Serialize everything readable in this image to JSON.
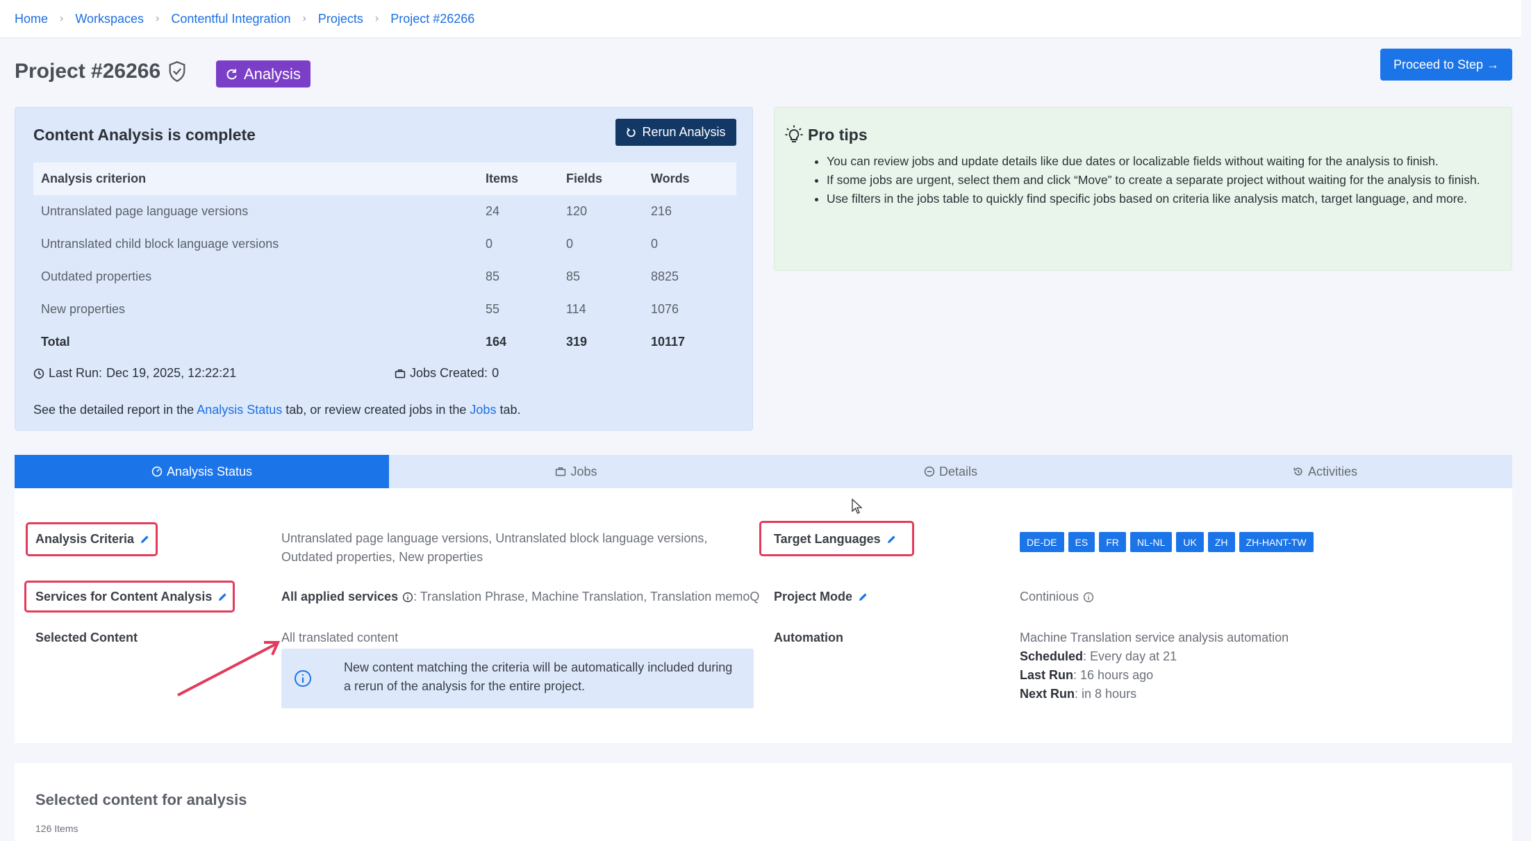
{
  "breadcrumb": [
    "Home",
    "Workspaces",
    "Contentful Integration",
    "Projects",
    "Project #26266"
  ],
  "header": {
    "project_title": "Project #26266",
    "status_label": "Analysis",
    "proceed_label": "Proceed to Step"
  },
  "analysis": {
    "title": "Content Analysis is complete",
    "rerun_label": "Rerun Analysis",
    "table": {
      "columns": [
        "Analysis criterion",
        "Items",
        "Fields",
        "Words"
      ],
      "rows": [
        [
          "Untranslated page language versions",
          "24",
          "120",
          "216"
        ],
        [
          "Untranslated child block language versions",
          "0",
          "0",
          "0"
        ],
        [
          "Outdated properties",
          "85",
          "85",
          "8825"
        ],
        [
          "New properties",
          "55",
          "114",
          "1076"
        ]
      ],
      "total": [
        "Total",
        "164",
        "319",
        "10117"
      ]
    },
    "last_run_label": "Last Run:",
    "last_run_value": "Dec 19, 2025, 12:22:21",
    "jobs_created_label": "Jobs Created:",
    "jobs_created_value": "0",
    "report_prefix": "See the detailed report in the",
    "report_link1": "Analysis Status",
    "report_mid": "tab, or review created jobs in the",
    "report_link2": "Jobs",
    "report_suffix": "tab."
  },
  "tips": {
    "title": "Pro tips",
    "items": [
      "You can review jobs and update details like due dates or localizable fields without waiting for the analysis to finish.",
      "If some jobs are urgent, select them and click “Move” to create a separate project without waiting for the analysis to finish.",
      "Use filters in the jobs table to quickly find specific jobs based on criteria like analysis match, target language, and more."
    ]
  },
  "tabs": [
    "Analysis Status",
    "Jobs",
    "Details",
    "Activities"
  ],
  "status": {
    "analysis_criteria_label": "Analysis Criteria",
    "analysis_criteria_value_line1": "Untranslated page language versions, Untranslated block language versions,",
    "analysis_criteria_value_line2": "Outdated properties, New properties",
    "services_label": "Services for Content Analysis",
    "services_prefix": "All applied services",
    "services_value": ": Translation Phrase, Machine Translation, Translation memoQ",
    "selected_content_label": "Selected Content",
    "selected_content_value": "All translated content",
    "info_text": "New content matching the criteria will be automatically included during a rerun of the analysis for the entire project.",
    "target_languages_label": "Target Languages",
    "target_languages": [
      "DE-DE",
      "ES",
      "FR",
      "NL-NL",
      "UK",
      "ZH",
      "ZH-HANT-TW"
    ],
    "project_mode_label": "Project Mode",
    "project_mode_value": "Continious",
    "automation_label": "Automation",
    "automation_link": "Machine Translation service analysis automation",
    "scheduled_label": "Scheduled",
    "scheduled_value": ": Every day at 21",
    "last_run_label": "Last Run",
    "last_run_value": ": 16 hours ago",
    "next_run_label": "Next Run",
    "next_run_value": ": in 8 hours"
  },
  "selected_content": {
    "title": "Selected content for analysis",
    "count": "126 Items"
  },
  "colors": {
    "primary": "#1b74e8",
    "status_pill": "#7b3fc7",
    "annotation": "#e23b5b"
  }
}
